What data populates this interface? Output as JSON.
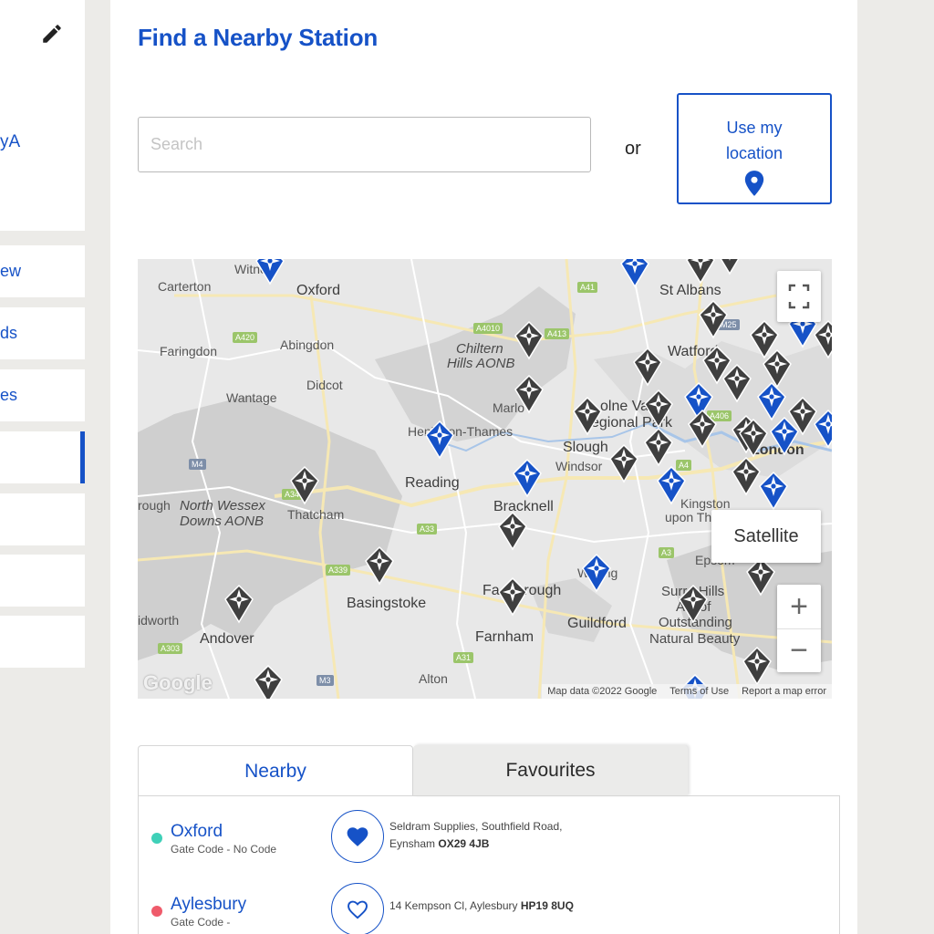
{
  "sidebar": {
    "profile_name_fragment": "yA",
    "items": [
      {
        "label": "ew"
      },
      {
        "label": "ds"
      },
      {
        "label": "es"
      },
      {
        "label": ""
      },
      {
        "label": ""
      },
      {
        "label": ""
      },
      {
        "label": ""
      }
    ]
  },
  "page": {
    "title": "Find a Nearby Station"
  },
  "search": {
    "placeholder": "Search",
    "value": ""
  },
  "or_label": "or",
  "location_button": {
    "label": "Use my location"
  },
  "map": {
    "labels": {
      "witney": "Witney",
      "carterton": "Carterton",
      "oxford": "Oxford",
      "st_albans": "St Albans",
      "faringdon": "Faringdon",
      "abingdon": "Abingdon",
      "chiltern": "Chiltern",
      "hills_aonb": "Hills AONB",
      "watford": "Watford",
      "wantage": "Wantage",
      "didcot": "Didcot",
      "marlow": "Marlo",
      "colne_valley": "olne Va",
      "regional_park": "egional Park",
      "henley": "Henl    on-Thames",
      "london": "London",
      "slough": "Slough",
      "windsor": "Windsor",
      "reading": "Reading",
      "bracknell": "Bracknell",
      "kingston": "Kingston",
      "upon_thames": "upon Thames",
      "north_wessex": "North Wessex",
      "downs_aonb": "Downs AONB",
      "rough": "rough",
      "thatcham": "Thatcham",
      "epsom": "Epsom",
      "woking": "W    ng",
      "farnborough": "Fa      rough",
      "surrey_hills": "Surr   Hills",
      "area_of": "A    of",
      "outstanding": "Outstanding",
      "natural_beauty": "Natural Beauty",
      "basingstoke": "Basingstoke",
      "guildford": "Guildford",
      "idworth": "idworth",
      "andover": "Andover",
      "farnham": "Farnham",
      "alton": "Alton"
    },
    "road_tags": [
      "A41",
      "A4010",
      "A413",
      "A420",
      "A34",
      "A4",
      "A33",
      "A339",
      "A303",
      "A31",
      "A3",
      "A406",
      "M4",
      "M3",
      "M25"
    ],
    "satellite_label": "Satellite",
    "zoom_in": "+",
    "zoom_out": "−",
    "google_logo": "Google",
    "attribution": {
      "data": "Map data ©2022 Google",
      "terms": "Terms of Use",
      "report": "Report a map error"
    },
    "marker_colors": {
      "gray": "#3f3f3f",
      "blue": "#1652c7"
    }
  },
  "tabs": [
    {
      "label": "Nearby",
      "active": true
    },
    {
      "label": "Favourites",
      "active": false
    }
  ],
  "stations": [
    {
      "name": "Oxford",
      "gate_code": "Gate Code - No Code",
      "status_color": "#3fd0b8",
      "favourite": true,
      "address": "Seldram Supplies, Southfield Road, Eynsham",
      "postcode": "OX29 4JB"
    },
    {
      "name": "Aylesbury",
      "gate_code": "Gate Code -",
      "status_color": "#ef5b6b",
      "favourite": false,
      "address": "14 Kempson Cl, Aylesbury",
      "postcode": "HP19 8UQ"
    }
  ],
  "colors": {
    "brand_blue": "#1652c7"
  }
}
